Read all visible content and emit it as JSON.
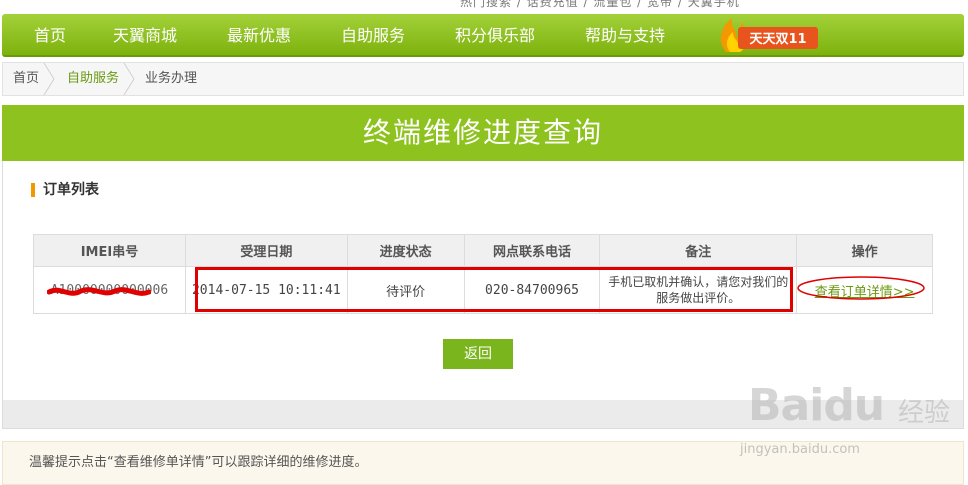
{
  "top_strip_text": "热门搜索 / 话费充值 / 流量包 / 宽带 / 天翼手机",
  "nav": {
    "items": [
      "首页",
      "天翼商城",
      "最新优惠",
      "自助服务",
      "积分俱乐部",
      "帮助与支持"
    ],
    "promo_text": "天天双11"
  },
  "breadcrumb": [
    "首页",
    "自助服务",
    "业务办理"
  ],
  "page_title": "终端维修进度查询",
  "order_section_title": "订单列表",
  "table": {
    "headers": [
      "IMEI串号",
      "受理日期",
      "进度状态",
      "网点联系电话",
      "备注",
      "操作"
    ],
    "rows": [
      {
        "imei": "A10000000000006",
        "date": "2014-07-15 10:11:41",
        "status": "待评价",
        "phone": "020-84700965",
        "note": "手机已取机并确认，请您对我们的服务做出评价。",
        "action": "查看订单详情>>"
      }
    ]
  },
  "back_button": "返回",
  "tip": "温馨提示点击“查看维修单详情”可以跟踪详细的维修进度。",
  "watermark": {
    "brand": "Bai",
    "brand_suffix": "du",
    "cn": "经验",
    "url": "jingyan.baidu.com"
  },
  "colors": {
    "nav_green": "#8dc21f",
    "accent_orange": "#f39800",
    "highlight_red": "#e00000",
    "link_green": "#6a9a10"
  }
}
